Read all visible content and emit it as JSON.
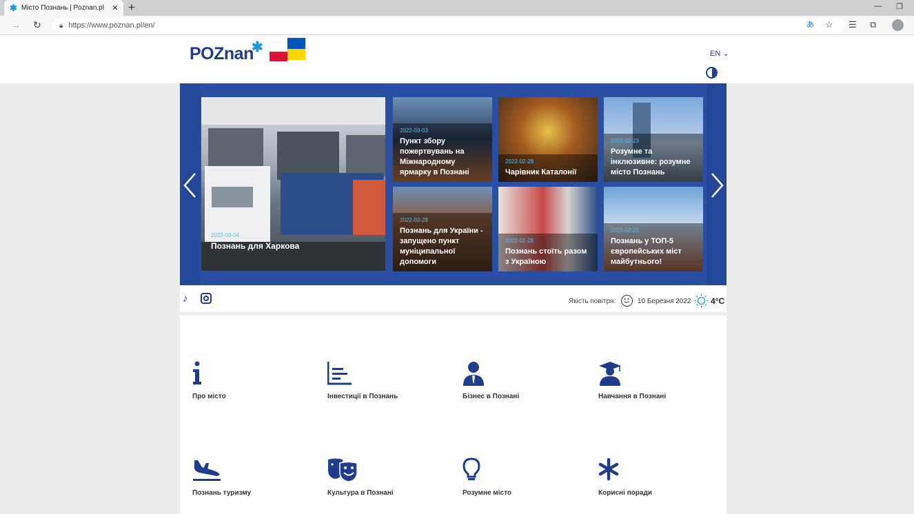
{
  "browser": {
    "tab_title": "Місто Познань | Poznan.pl",
    "url": "https://www.poznan.pl/en/"
  },
  "header": {
    "logo_text": "POZnan",
    "lang": "EN"
  },
  "slider": {
    "featured": {
      "date": "2022-03-04",
      "title": "Познань для Харкова"
    },
    "items": [
      {
        "date": "2022-03-03",
        "title": "Пункт збору пожертвувань на Міжнародному ярмарку в Познані"
      },
      {
        "date": "2022-02-28",
        "title": "Чарівник Каталонії"
      },
      {
        "date": "2022-02-23",
        "title": "Розумне та інклюзивне: розумне місто Познань"
      },
      {
        "date": "2022-02-28",
        "title": "Познань для України - запущено пункт муніципальної допомоги"
      },
      {
        "date": "2022-02-28",
        "title": "Познань стоїть разом з Україною"
      },
      {
        "date": "2022-02-22",
        "title": "Познань у ТОП-5 європейських міст майбутнього!"
      }
    ]
  },
  "info": {
    "air_label": "Якість повітря:",
    "date": "10 Березня 2022",
    "temperature": "4°C"
  },
  "quicklinks": [
    {
      "label": "Про місто",
      "icon": "info-icon"
    },
    {
      "label": "Інвестиції в Познань",
      "icon": "chart-icon"
    },
    {
      "label": "Бізнес в Познані",
      "icon": "businessman-icon"
    },
    {
      "label": "Навчання в Познані",
      "icon": "graduate-icon"
    },
    {
      "label": "Познань туризму",
      "icon": "airplane-icon"
    },
    {
      "label": "Культура в Познані",
      "icon": "theatre-masks-icon"
    },
    {
      "label": "Розумне місто",
      "icon": "lightbulb-icon"
    },
    {
      "label": "Корисні поради",
      "icon": "asterisk-icon"
    }
  ],
  "colors": {
    "brand": "#1f3d8a",
    "accent": "#1a9ad8",
    "slider_bg": "#2a4fa2"
  }
}
